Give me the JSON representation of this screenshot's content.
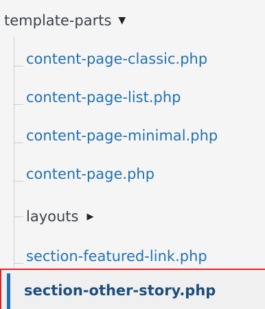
{
  "folder": {
    "label": "template-parts",
    "arrow": "▼"
  },
  "files": [
    "content-page-classic.php",
    "content-page-list.php",
    "content-page-minimal.php",
    "content-page.php"
  ],
  "subfolder": {
    "label": "layouts",
    "arrow": "▶"
  },
  "files_after": [
    "section-featured-link.php"
  ],
  "active_file": "section-other-story.php",
  "colors": {
    "link": "#2271b1",
    "active_text": "#1d4f7c",
    "highlight_border": "#e02424"
  }
}
